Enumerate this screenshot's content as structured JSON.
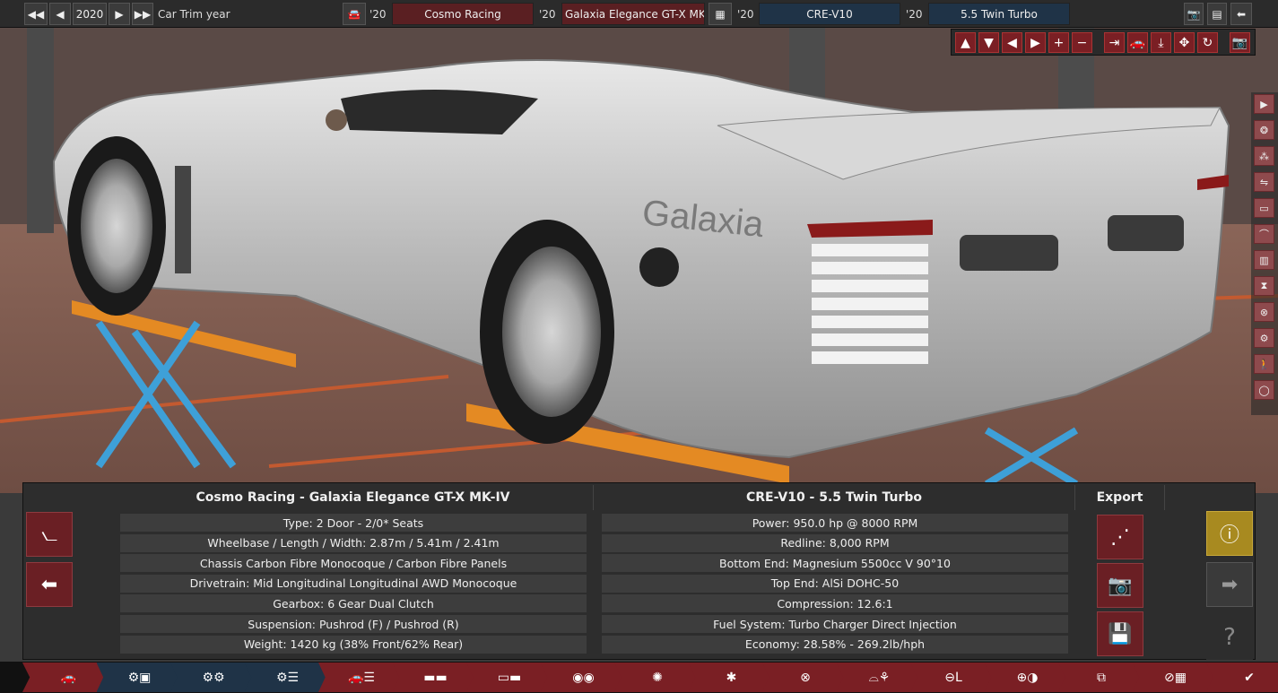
{
  "topbar": {
    "year": "2020",
    "trim_label": "Car Trim year",
    "model_year_prefix": "'20",
    "brand": "Cosmo Racing",
    "model_year_prefix2": "'20",
    "model": "Galaxia Elegance GT-X MK-I",
    "engine_year_prefix": "'20",
    "engine_family": "CRE-V10",
    "variant_year_prefix": "'20",
    "engine_variant": "5.5 Twin Turbo"
  },
  "ctrl_icons": [
    "up-arrow-icon",
    "down-arrow-icon",
    "left-arrow-icon",
    "right-arrow-icon",
    "plus-icon",
    "minus-icon",
    "snap-icon",
    "car-icon",
    "ground-icon",
    "move-icon",
    "reset-icon",
    "camera-icon"
  ],
  "ctrl_glyphs": [
    "▲",
    "▼",
    "◀",
    "▶",
    "+",
    "−",
    "⇥",
    "🚗",
    "⤓",
    "✥",
    "↻",
    "📷"
  ],
  "side_glyphs": [
    "▶",
    "❂",
    "⁂",
    "⇋",
    "▭",
    "⌒",
    "▥",
    "⧗",
    "⊗",
    "⚙",
    "🚶",
    "◯"
  ],
  "car_badge": "Galaxia",
  "panel": {
    "car_title": "Cosmo Racing - Galaxia Elegance GT-X MK-IV",
    "engine_title": "CRE-V10 - 5.5 Twin Turbo",
    "export_title": "Export",
    "car_rows": [
      "Type: 2 Door - 2/0* Seats",
      "Wheelbase / Length / Width: 2.87m / 5.41m / 2.41m",
      "Chassis Carbon Fibre Monocoque / Carbon Fibre Panels",
      "Drivetrain: Mid Longitudinal Longitudinal AWD Monocoque",
      "Gearbox: 6 Gear Dual Clutch",
      "Suspension: Pushrod (F) / Pushrod (R)",
      "Weight: 1420 kg (38% Front/62% Rear)"
    ],
    "engine_rows": [
      "Power: 950.0 hp @ 8000 RPM",
      "Redline:  8,000 RPM",
      "Bottom End: Magnesium 5500cc V 90°10",
      "Top End: AlSi DOHC-50",
      "Compression: 12.6:1",
      "Fuel System: Turbo Charger Direct Injection",
      "Economy: 28.58% - 269.2lb/hph"
    ]
  },
  "colors": {
    "accent_red": "#7a1f24",
    "accent_blue": "#1f3347",
    "warning_gold": "#a88a20"
  }
}
